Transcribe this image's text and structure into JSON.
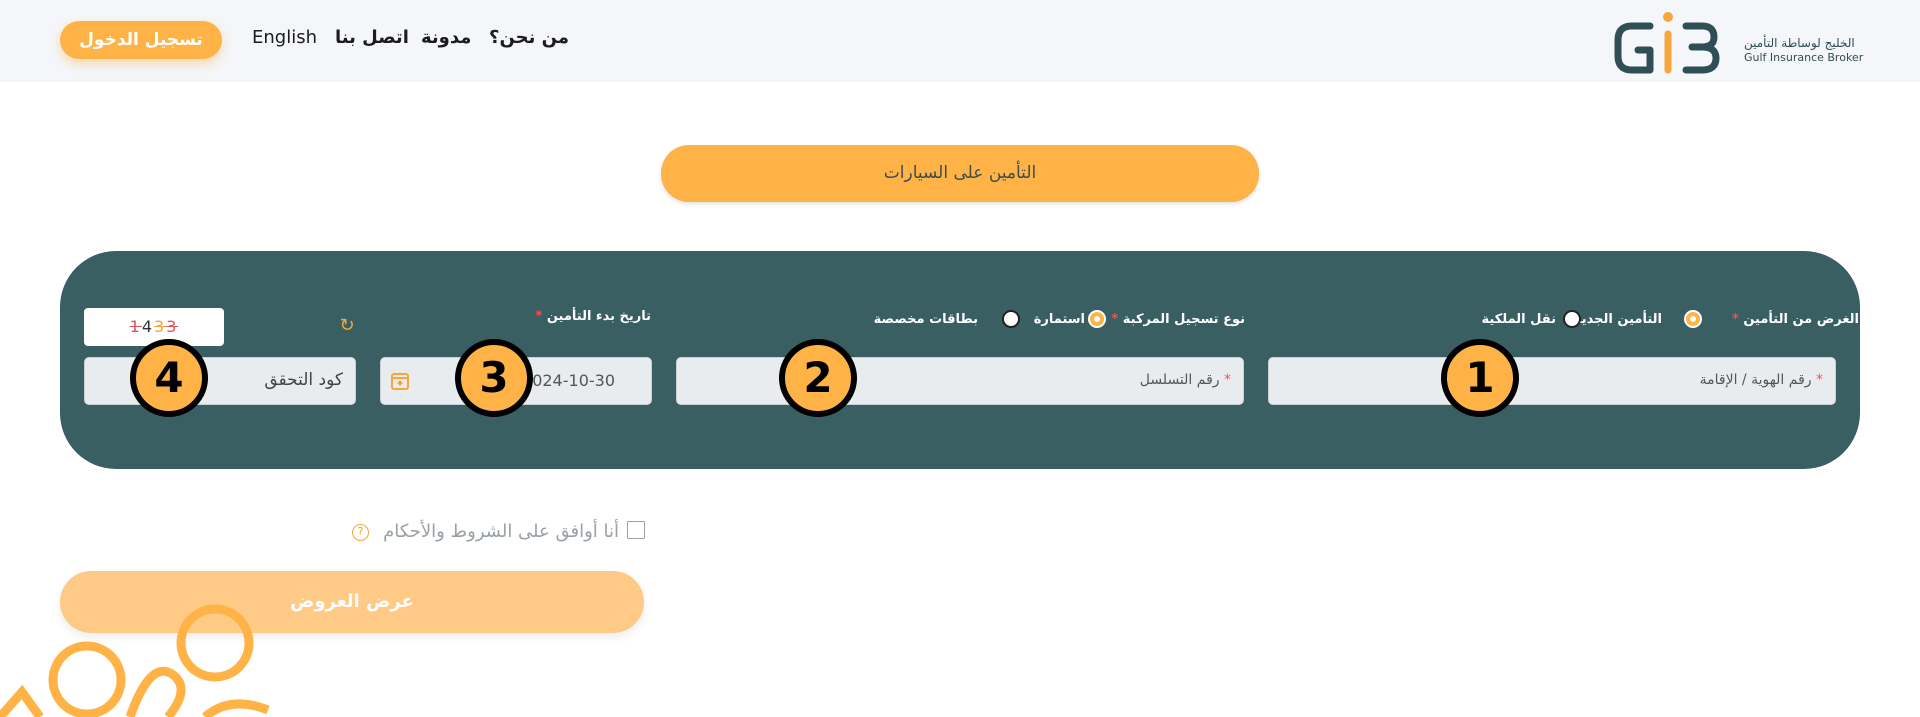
{
  "header": {
    "login_label": "تسجيل الدخول",
    "nav": [
      "English",
      "اتصل بنا",
      "مدونة",
      "من نحن؟"
    ],
    "logo": {
      "mark": "GIB",
      "name_ar": "الخليج لوساطة التأمين",
      "name_en": "Gulf Insurance Broker"
    }
  },
  "banner": {
    "label": "التأمين على السيارات"
  },
  "form": {
    "purpose": {
      "label": "الغرض من التأمين",
      "required_mark": "*",
      "options": [
        "التأمين الجديد",
        "نقل الملكية"
      ],
      "selected": "التأمين الجديد"
    },
    "registration_type": {
      "label": "نوع تسجيل المركبة",
      "required_mark": "*",
      "options": [
        "استمارة",
        "بطاقات مخصصة"
      ],
      "selected": "استمارة"
    },
    "start_date": {
      "label": "تاريخ بدء التأمين",
      "required_mark": "*",
      "value": "2024-10-30"
    },
    "id_field": {
      "placeholder": "رقم الهوية / الإقامة",
      "required_mark": "*"
    },
    "serial_field": {
      "placeholder": "رقم التسلسل",
      "required_mark": "*"
    },
    "verification_field": {
      "placeholder": "كود التحقق"
    },
    "captcha": {
      "digits": [
        "1",
        "4",
        "3",
        "3"
      ]
    },
    "badges": [
      "1",
      "2",
      "3",
      "4"
    ]
  },
  "terms": {
    "label": "أنا أوافق على الشروط والأحكام",
    "help": "?"
  },
  "submit": {
    "label": "عرض العروض"
  },
  "colors": {
    "accent": "#ffb347",
    "panel": "#3a5f63",
    "required": "#ff4b4b"
  }
}
